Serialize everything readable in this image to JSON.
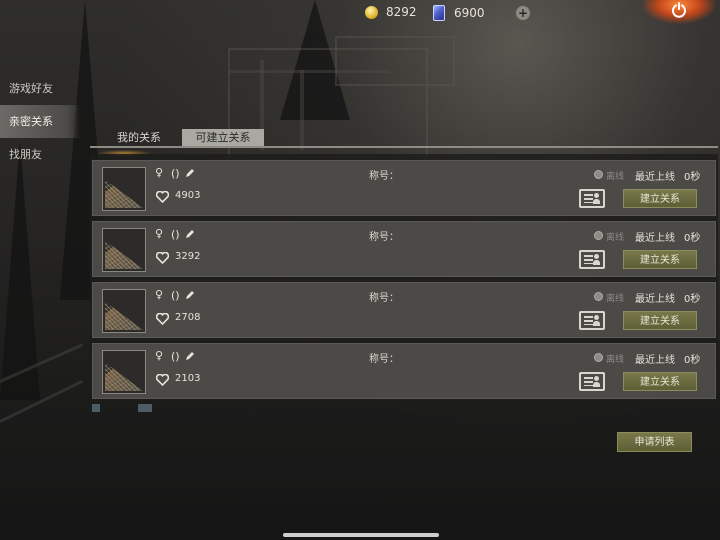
{
  "top_bar": {
    "gold": "8292",
    "gems": "6900",
    "plus_icon": "plus-circle-icon",
    "power_icon": "power-icon"
  },
  "side_nav": {
    "items": [
      {
        "label": "游戏好友",
        "active": false
      },
      {
        "label": "亲密关系",
        "active": true
      },
      {
        "label": "找朋友",
        "active": false
      }
    ]
  },
  "tabs": [
    {
      "label": "我的关系",
      "active": false
    },
    {
      "label": "可建立关系",
      "active": true
    }
  ],
  "relationship_list": [
    {
      "gender": "♀",
      "name": "()",
      "score": "4903",
      "title_label": "称号：",
      "status": "离线",
      "last_online_label": "最近上线",
      "last_online_value": "0秒",
      "build_label": "建立关系"
    },
    {
      "gender": "♀",
      "name": "()",
      "score": "3292",
      "title_label": "称号：",
      "status": "离线",
      "last_online_label": "最近上线",
      "last_online_value": "0秒",
      "build_label": "建立关系"
    },
    {
      "gender": "♀",
      "name": "()",
      "score": "2708",
      "title_label": "称号：",
      "status": "离线",
      "last_online_label": "最近上线",
      "last_online_value": "0秒",
      "build_label": "建立关系"
    },
    {
      "gender": "♀",
      "name": "()",
      "score": "2103",
      "title_label": "称号：",
      "status": "离线",
      "last_online_label": "最近上线",
      "last_online_value": "0秒",
      "build_label": "建立关系"
    }
  ],
  "apply_list_label": "申请列表",
  "colors": {
    "button_olive": "#6b6b3f",
    "card_bg": "#4c4a47",
    "tab_active_bg": "#aaa8a3"
  }
}
